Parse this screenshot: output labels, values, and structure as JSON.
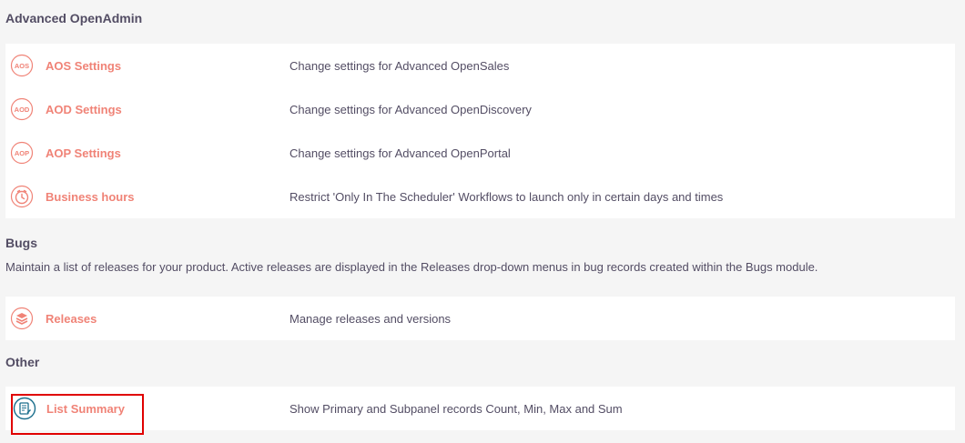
{
  "sections": {
    "aos": {
      "title": "Advanced OpenAdmin",
      "rows": [
        {
          "icon": "aos-icon",
          "icon_text": "AOS",
          "label": "AOS Settings",
          "desc": "Change settings for Advanced OpenSales"
        },
        {
          "icon": "aod-icon",
          "icon_text": "AOD",
          "label": "AOD Settings",
          "desc": "Change settings for Advanced OpenDiscovery"
        },
        {
          "icon": "aop-icon",
          "icon_text": "AOP",
          "label": "AOP Settings",
          "desc": "Change settings for Advanced OpenPortal"
        },
        {
          "icon": "clock-icon",
          "label": "Business hours",
          "desc": "Restrict 'Only In The Scheduler' Workflows to launch only in certain days and times"
        }
      ]
    },
    "bugs": {
      "title": "Bugs",
      "description": "Maintain a list of releases for your product. Active releases are displayed in the Releases drop-down menus in bug records created within the Bugs module.",
      "rows": [
        {
          "icon": "releases-icon",
          "label": "Releases",
          "desc": "Manage releases and versions"
        }
      ]
    },
    "other": {
      "title": "Other",
      "rows": [
        {
          "icon": "list-summary-icon",
          "label": "List Summary",
          "desc": "Show Primary and Subpanel records Count, Min, Max and Sum"
        }
      ]
    }
  },
  "colors": {
    "accent": "#f08377",
    "text": "#534d64",
    "highlight": "#e00000",
    "list_summary_icon": "#1a6e8c"
  }
}
